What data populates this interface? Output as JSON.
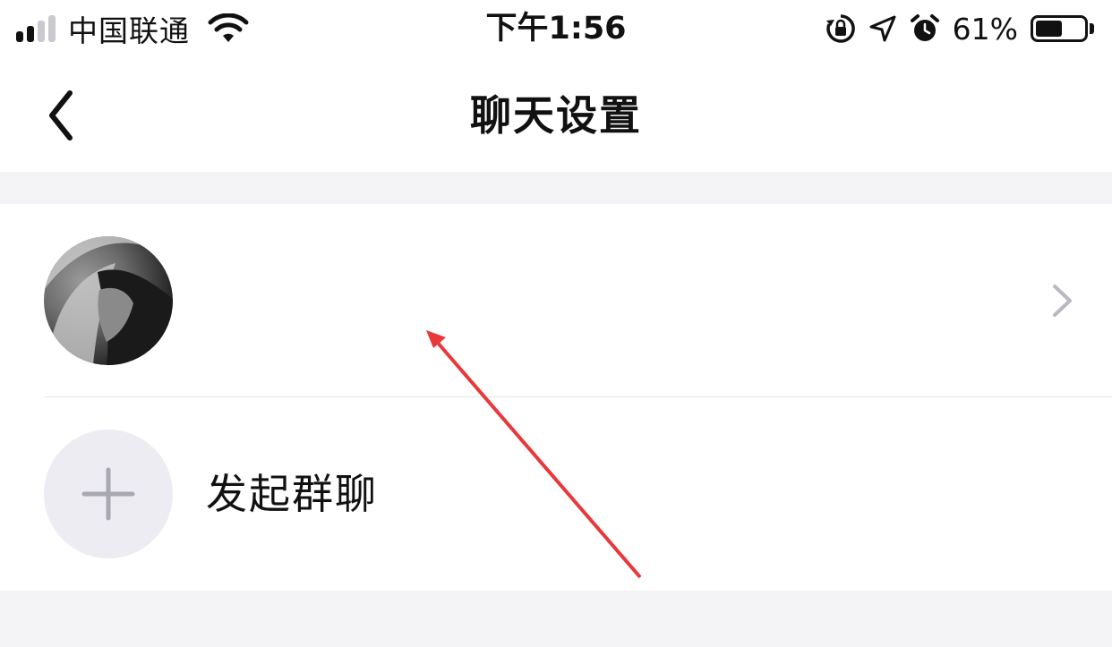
{
  "status_bar": {
    "carrier": "中国联通",
    "time": "下午1:56",
    "battery_percent": "61%",
    "battery_level": 0.61,
    "icons": [
      "signal-icon",
      "wifi-icon",
      "rotation-lock-icon",
      "location-icon",
      "alarm-icon",
      "battery-icon"
    ]
  },
  "nav": {
    "title": "聊天设置",
    "back_icon": "chevron-left-icon"
  },
  "contact_row": {
    "avatar": "avatar",
    "chevron_icon": "chevron-right-icon"
  },
  "group_row": {
    "label": "发起群聊",
    "icon": "plus-icon"
  },
  "annotation": {
    "arrow_color": "#e8383a"
  },
  "colors": {
    "background": "#f4f4f7",
    "card": "#ffffff",
    "plus_bg": "#ececf2",
    "chevron": "#b9b9c3"
  }
}
